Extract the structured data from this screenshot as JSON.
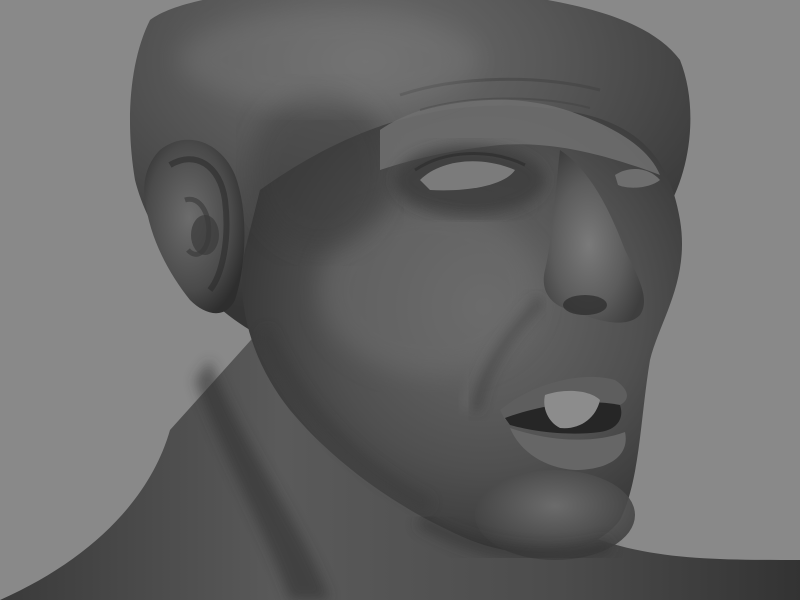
{
  "viewport": {
    "background_color": "#898989",
    "subject": "sculpted-head-render",
    "material_color": "#5a5a5a"
  }
}
